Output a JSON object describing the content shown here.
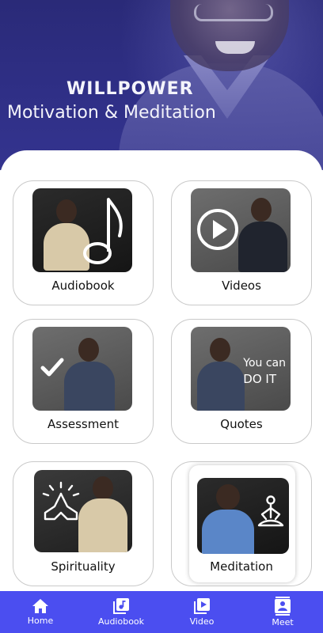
{
  "header": {
    "title": "WILLPOWER",
    "subtitle": "Motivation  & Meditation"
  },
  "cards": [
    {
      "label": "Audiobook",
      "icon": "music-note-icon"
    },
    {
      "label": "Videos",
      "icon": "play-circle-icon"
    },
    {
      "label": "Assessment",
      "icon": "checkmark-icon"
    },
    {
      "label": "Quotes",
      "icon": "quote-text",
      "overlay_line1": "You can",
      "overlay_line2": "DO IT"
    },
    {
      "label": "Spirituality",
      "icon": "praying-hands-icon"
    },
    {
      "label": "Meditation",
      "icon": "meditation-icon",
      "selected": true
    }
  ],
  "bottom_nav": [
    {
      "label": "Home",
      "icon": "home-icon"
    },
    {
      "label": "Audiobook",
      "icon": "audiobook-icon"
    },
    {
      "label": "Video",
      "icon": "video-icon"
    },
    {
      "label": "Meet",
      "icon": "contact-card-icon"
    }
  ],
  "colors": {
    "header_bg": "#2f2f86",
    "nav_bg": "#4b4ef0",
    "card_border": "#c9c9c9"
  }
}
